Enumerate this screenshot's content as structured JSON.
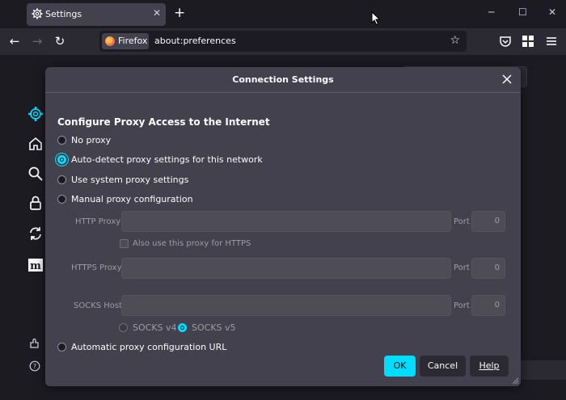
{
  "tab": {
    "title": "Settings",
    "close_glyph": "✕",
    "new_tab_glyph": "+"
  },
  "window_controls": {
    "minimize": "─",
    "maximize": "☐",
    "close": "✕"
  },
  "navbar": {
    "back": "←",
    "forward": "→",
    "reload": "↻",
    "identity_label": "Firefox",
    "url": "about:preferences",
    "bookmark_glyph": "☆"
  },
  "dialog": {
    "title": "Connection Settings",
    "section_title": "Configure Proxy Access to the Internet",
    "options": {
      "no_proxy": "No proxy",
      "auto_detect": "Auto-detect proxy settings for this network",
      "system": "Use system proxy settings",
      "manual": "Manual proxy configuration",
      "auto_url": "Automatic proxy configuration URL"
    },
    "selected_option": "auto_detect",
    "manual": {
      "http_label": "HTTP Proxy",
      "https_checkbox_label": "Also use this proxy for HTTPS",
      "https_label": "HTTPS Proxy",
      "socks_label": "SOCKS Host",
      "port_label": "Port",
      "http_port": "0",
      "https_port": "0",
      "socks_port": "0",
      "socks_v4": "SOCKS v4",
      "socks_v5": "SOCKS v5",
      "socks_selected": "v5"
    },
    "buttons": {
      "ok": "OK",
      "cancel": "Cancel",
      "help": "Help"
    }
  },
  "colors": {
    "accent": "#00ddff",
    "dialog_bg": "#42414d",
    "page_bg": "#1c1b22"
  }
}
